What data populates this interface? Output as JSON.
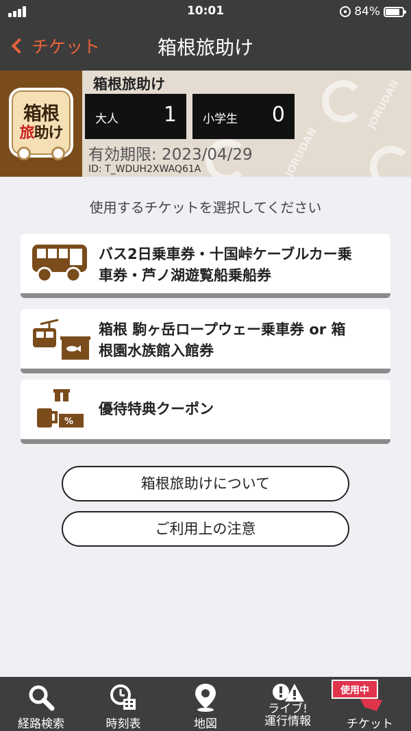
{
  "status_bar": {
    "time": "10:01",
    "battery": "84%"
  },
  "nav": {
    "back_label": "チケット",
    "title": "箱根旅助け"
  },
  "ticket": {
    "logo_line1": "箱根",
    "logo_line2_red": "旅",
    "logo_line2_rest": "助け",
    "watermark": "JORUDAN",
    "title": "箱根旅助け",
    "adult_label": "大人",
    "adult_count": "1",
    "child_label": "小学生",
    "child_count": "0",
    "validity": "有効期限: 2023/04/29",
    "id": "ID: T_WDUH2XWAQ61A"
  },
  "main": {
    "instruction": "使用するチケットを選択してください",
    "options": [
      {
        "line1": "バス2日乗車券・十国峠ケーブルカー乗",
        "line2": "車券・芦ノ湖遊覧船乗船券",
        "icon": "bus-icon"
      },
      {
        "line1": "箱根 駒ヶ岳ロープウェー乗車券 or 箱",
        "line2": "根園水族館入館券",
        "icon": "ropeway-aquarium-icon"
      },
      {
        "line1": "優待特典クーポン",
        "icon": "coupon-icon"
      }
    ],
    "about_button": "箱根旅助けについて",
    "notes_button": "ご利用上の注意"
  },
  "tabbar": {
    "tabs": [
      {
        "label": "経路検索",
        "icon": "search-icon"
      },
      {
        "label": "時刻表",
        "icon": "clock-icon"
      },
      {
        "label": "地図",
        "icon": "map-pin-icon"
      },
      {
        "label_line1": "ライブ!",
        "label_line2": "運行情報",
        "icon": "live-info-icon"
      },
      {
        "label": "チケット",
        "icon": "ticket-icon"
      }
    ],
    "active_badge": "使用中"
  },
  "colors": {
    "accent": "#e8643a",
    "brown": "#7a4c1c",
    "badge": "#e0344d"
  }
}
